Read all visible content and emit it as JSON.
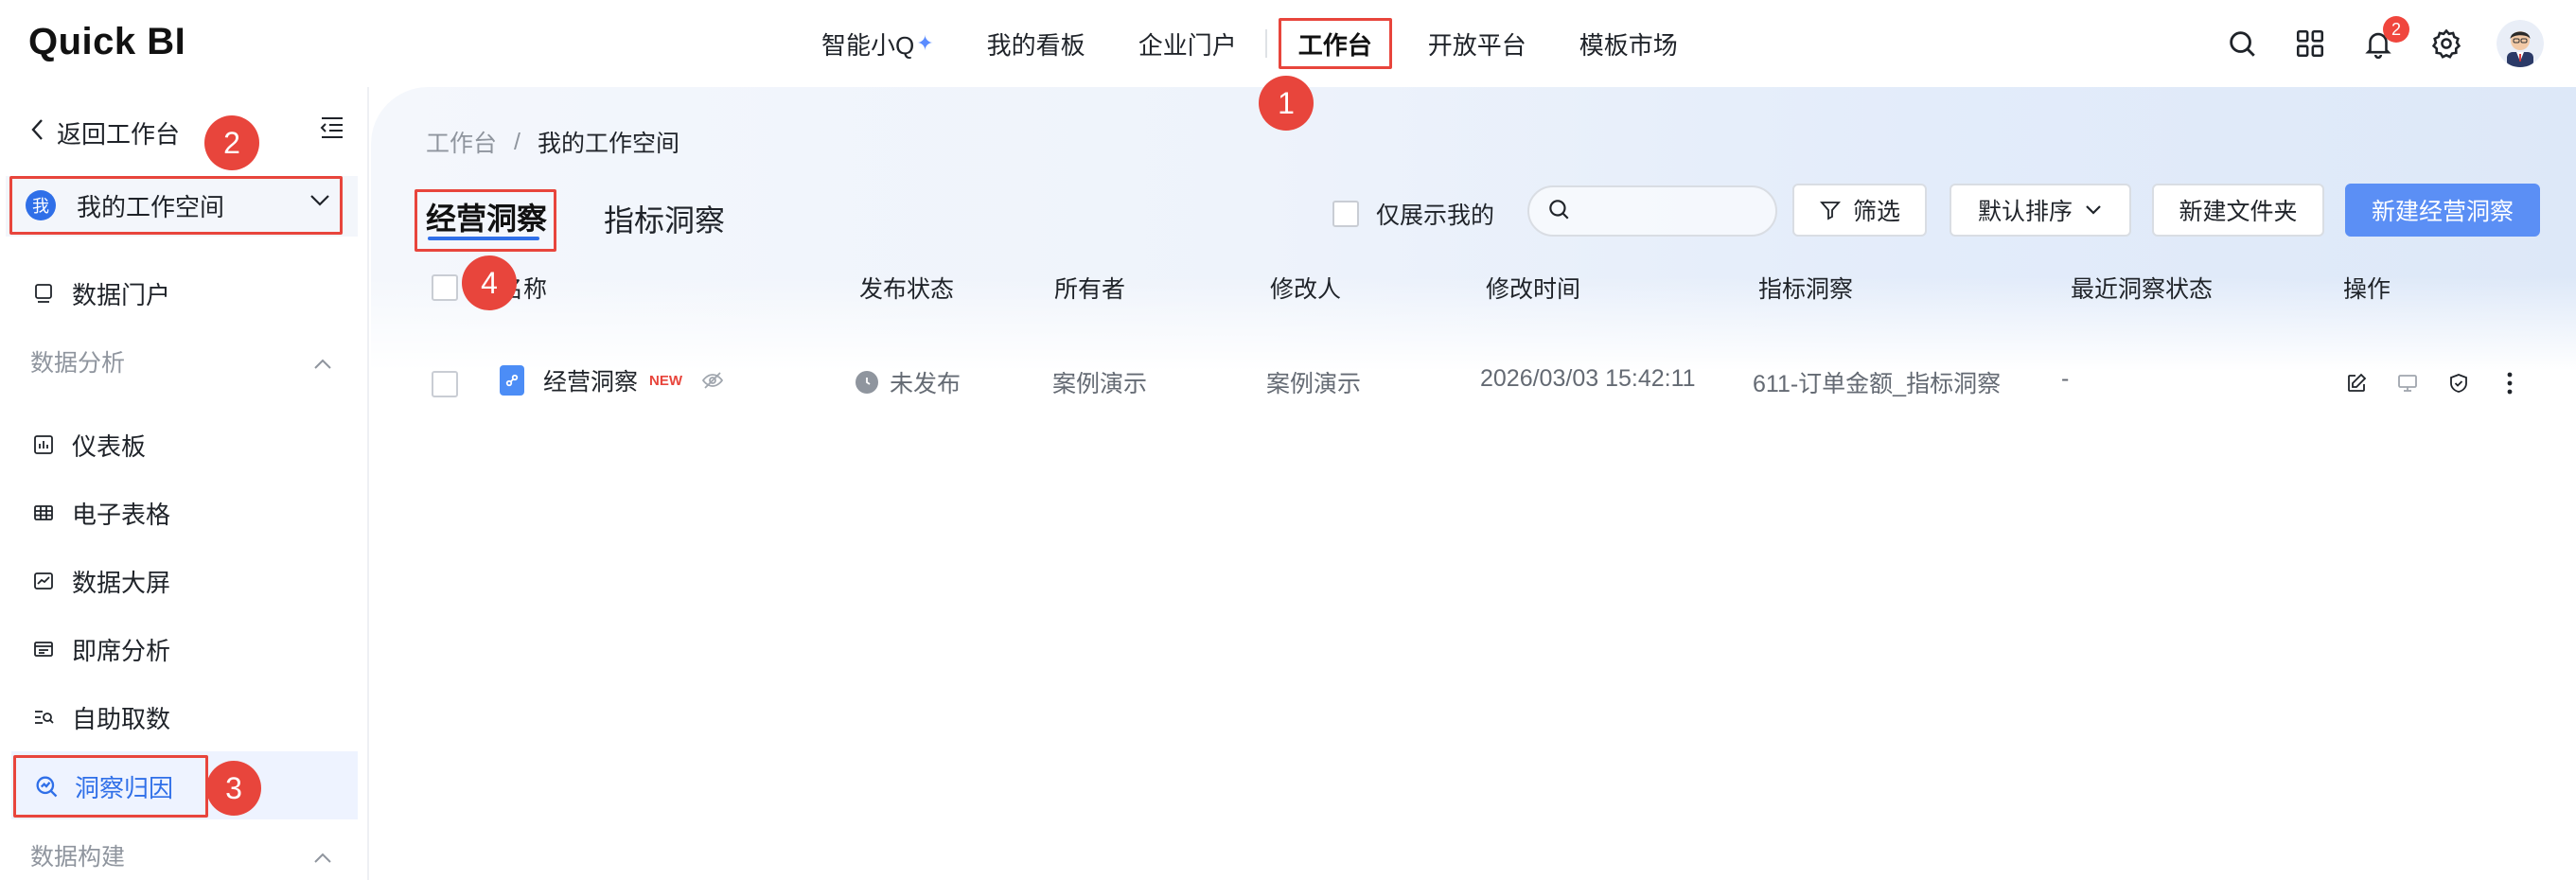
{
  "app": {
    "logo": "Quick BI"
  },
  "nav": {
    "items": [
      {
        "label": "智能小Q",
        "spark": "✦"
      },
      {
        "label": "我的看板"
      },
      {
        "label": "企业门户"
      },
      {
        "label": "工作台"
      },
      {
        "label": "开放平台"
      },
      {
        "label": "模板市场"
      }
    ],
    "active": "工作台"
  },
  "top_icons": {
    "search": "search-icon",
    "apps": "grid-icon",
    "notifications": "bell-icon",
    "notification_count": "2",
    "settings": "gear-icon",
    "avatar": "user-avatar"
  },
  "sidebar": {
    "back_label": "返回工作台",
    "workspace": {
      "avatar_char": "我",
      "label": "我的工作空间"
    },
    "items": [
      {
        "label": "数据门户",
        "icon": "portal-icon"
      },
      {
        "group": "数据分析"
      },
      {
        "label": "仪表板",
        "icon": "dashboard-icon"
      },
      {
        "label": "电子表格",
        "icon": "spreadsheet-icon"
      },
      {
        "label": "数据大屏",
        "icon": "screen-icon"
      },
      {
        "label": "即席分析",
        "icon": "adhoc-icon"
      },
      {
        "label": "自助取数",
        "icon": "self-service-icon"
      },
      {
        "label": "洞察归因",
        "icon": "insight-icon",
        "active": true
      },
      {
        "group": "数据构建"
      }
    ]
  },
  "steps": [
    "1",
    "2",
    "3",
    "4"
  ],
  "main": {
    "breadcrumb": [
      "工作台",
      "我的工作空间"
    ],
    "breadcrumb_sep": "/",
    "tabs": [
      "经营洞察",
      "指标洞察"
    ],
    "only_mine_label": "仅展示我的",
    "search_placeholder": "",
    "filter_label": "筛选",
    "sort_label": "默认排序",
    "new_folder_label": "新建文件夹",
    "new_insight_label": "新建经营洞察",
    "columns": [
      "名称",
      "发布状态",
      "所有者",
      "修改人",
      "修改时间",
      "指标洞察",
      "最近洞察状态",
      "操作"
    ],
    "rows": [
      {
        "name": "经营洞察",
        "new_tag": "NEW",
        "status": "未发布",
        "owner": "案例演示",
        "modifier": "案例演示",
        "modified_time": "2026/03/03 15:42:11",
        "metric_insight": "611-订单金额_指标洞察",
        "recent_status": "-"
      }
    ]
  },
  "colors": {
    "accent": "#2f6fe8",
    "highlight": "#e8453c",
    "primary_button": "#5b8ff5"
  }
}
